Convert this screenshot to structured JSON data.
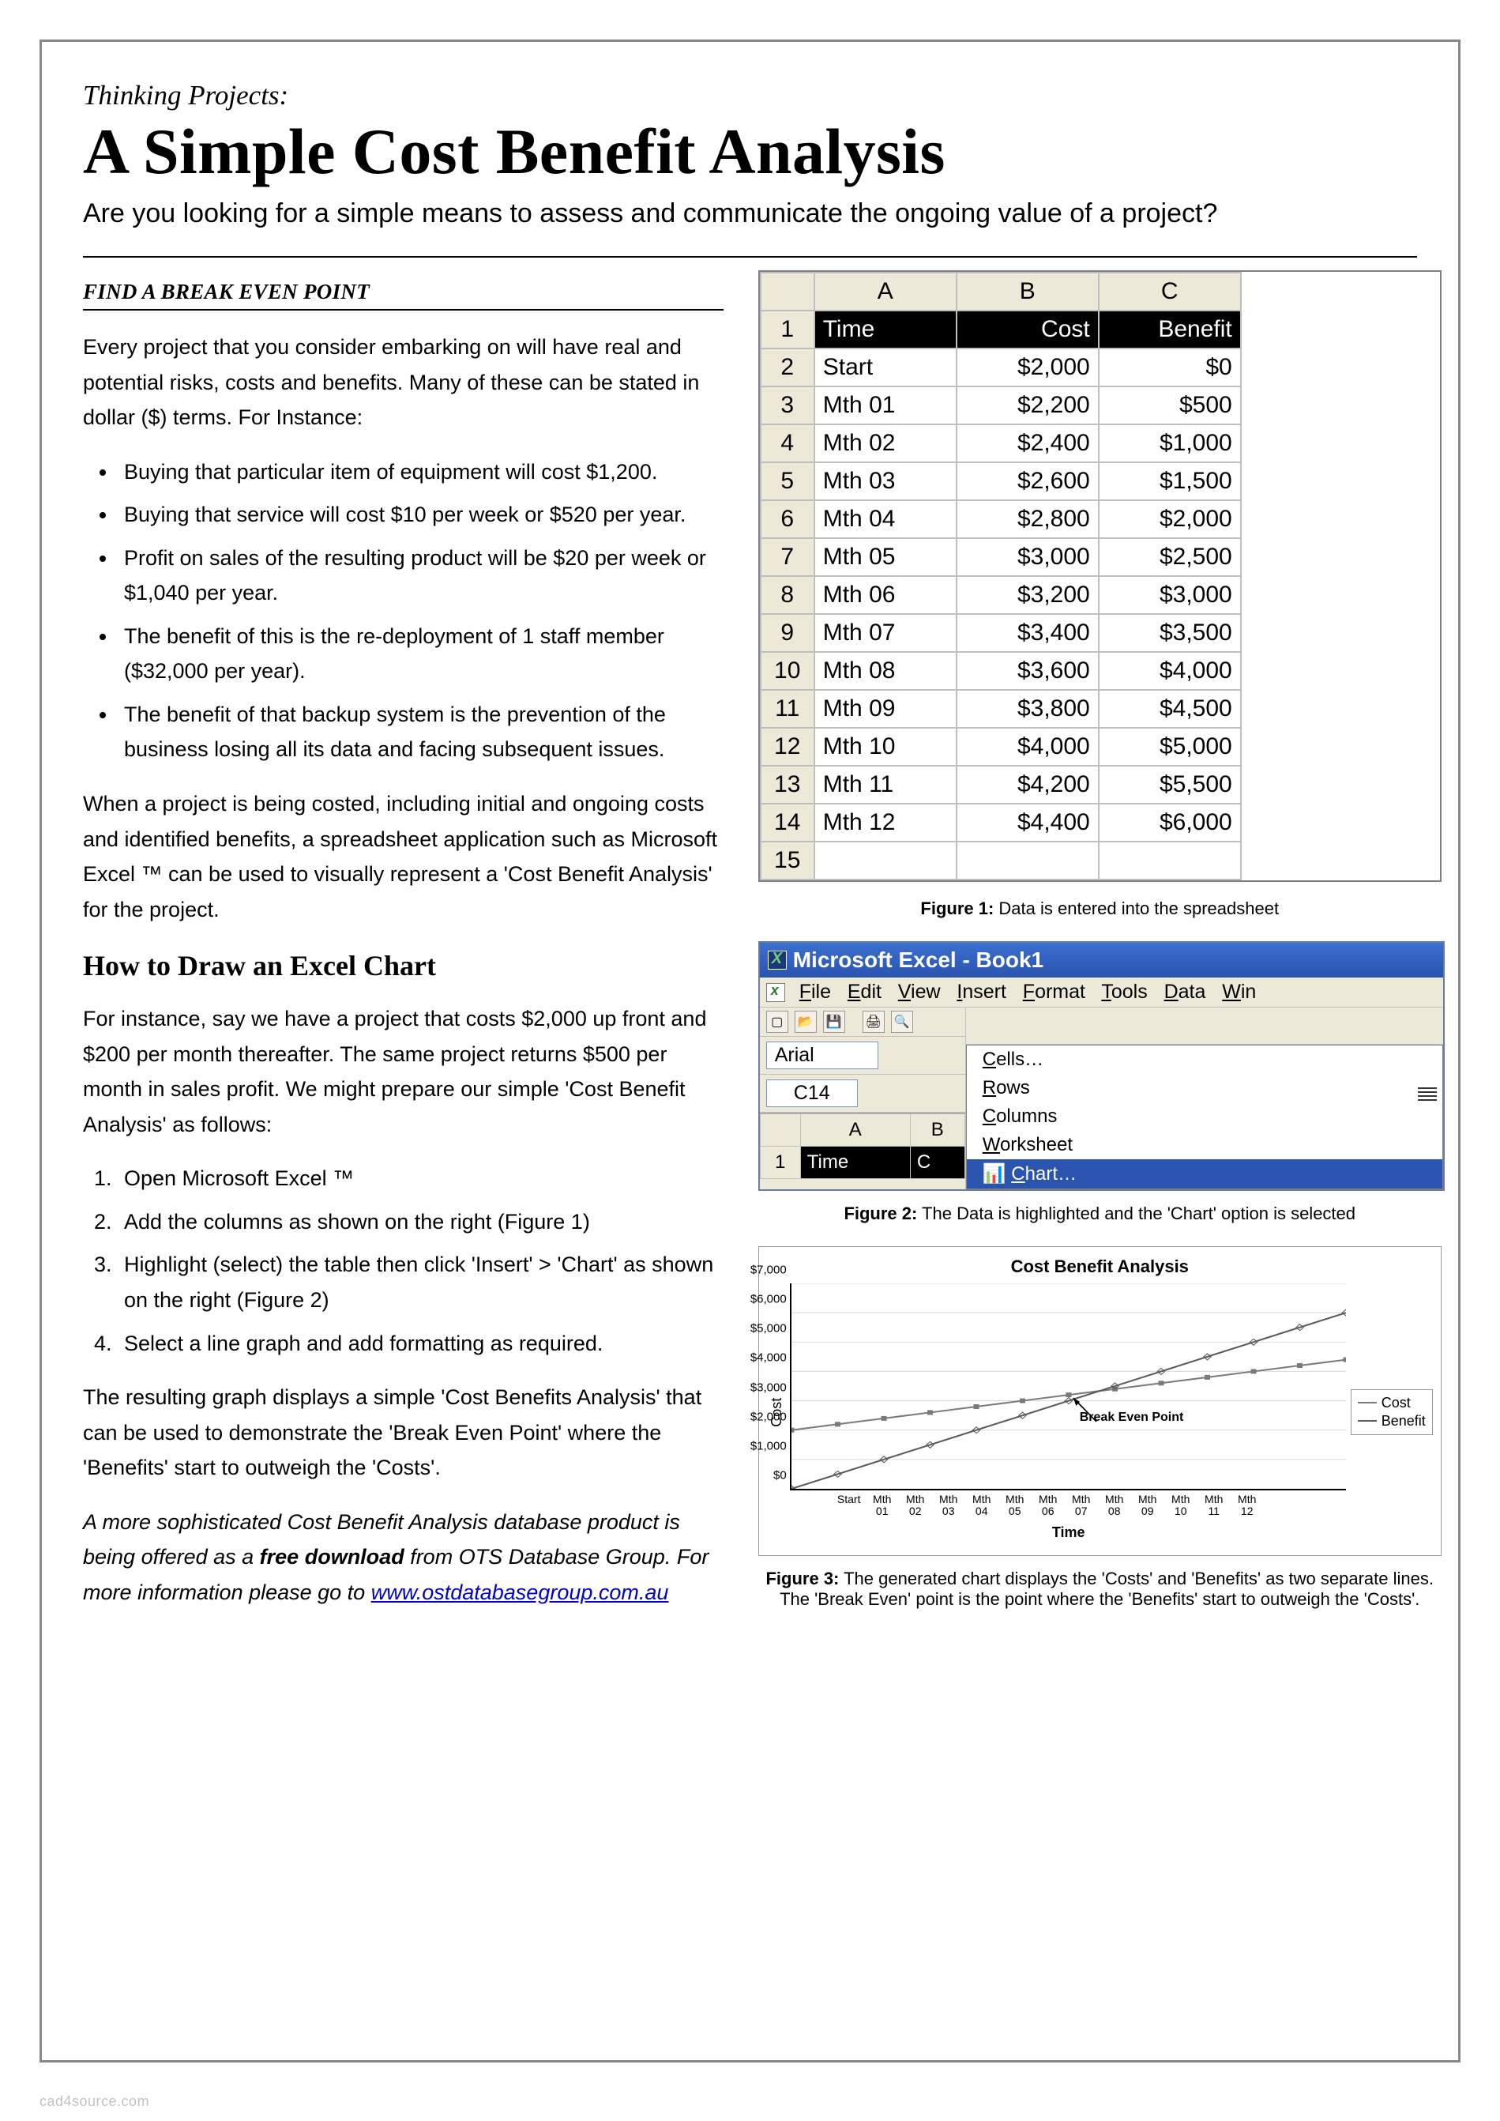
{
  "header": {
    "pre_title": "Thinking Projects:",
    "title": "A Simple Cost Benefit Analysis",
    "subtitle": "Are you looking for a simple means to assess and communicate the ongoing value of a project?"
  },
  "left": {
    "section_label": "FIND A BREAK EVEN POINT",
    "intro": "Every project that you consider embarking on will have real and potential risks, costs and benefits.  Many of these can be stated in dollar ($) terms.  For Instance:",
    "bullets": [
      "Buying that particular item of equipment will cost $1,200.",
      "Buying that service will cost $10 per week or $520 per year.",
      "Profit on sales of the resulting product will be $20 per week or $1,040 per year.",
      "The benefit of this is the re-deployment of 1 staff member ($32,000 per year).",
      "The benefit of that backup system is the prevention of the business losing all its data and facing subsequent issues."
    ],
    "para2": "When a project is being costed, including initial and ongoing costs and identified benefits, a spreadsheet application such as Microsoft Excel ™ can be used to visually represent a 'Cost Benefit Analysis' for the project.",
    "h2": "How to Draw an Excel Chart",
    "para3": "For instance, say we have a project that costs $2,000 up front and $200 per month thereafter. The same project returns $500 per month in sales profit.  We might prepare our simple 'Cost Benefit Analysis' as follows:",
    "steps": [
      "Open Microsoft Excel ™",
      "Add the columns as shown on the right (Figure 1)",
      "Highlight (select) the table then click 'Insert' > 'Chart' as shown on the right (Figure 2)",
      "Select a line graph and add formatting as required."
    ],
    "para4": "The resulting graph displays a simple 'Cost Benefits Analysis' that can be used to demonstrate the 'Break Even Point' where the 'Benefits' start to outweigh the 'Costs'.",
    "footer_italic_pre": "A more sophisticated Cost Benefit Analysis database product is being offered as a ",
    "footer_bold": "free download",
    "footer_italic_post": " from OTS Database Group.  For more information please go to ",
    "footer_link": "www.ostdatabasegroup.com.au"
  },
  "figure1": {
    "col_headers": [
      "A",
      "B",
      "C"
    ],
    "data_headers": [
      "Time",
      "Cost",
      "Benefit"
    ],
    "row_labels": [
      "1",
      "2",
      "3",
      "4",
      "5",
      "6",
      "7",
      "8",
      "9",
      "10",
      "11",
      "12",
      "13",
      "14",
      "15"
    ],
    "rows": [
      [
        "Start",
        "$2,000",
        "$0"
      ],
      [
        "Mth 01",
        "$2,200",
        "$500"
      ],
      [
        "Mth 02",
        "$2,400",
        "$1,000"
      ],
      [
        "Mth 03",
        "$2,600",
        "$1,500"
      ],
      [
        "Mth 04",
        "$2,800",
        "$2,000"
      ],
      [
        "Mth 05",
        "$3,000",
        "$2,500"
      ],
      [
        "Mth 06",
        "$3,200",
        "$3,000"
      ],
      [
        "Mth 07",
        "$3,400",
        "$3,500"
      ],
      [
        "Mth 08",
        "$3,600",
        "$4,000"
      ],
      [
        "Mth 09",
        "$3,800",
        "$4,500"
      ],
      [
        "Mth 10",
        "$4,000",
        "$5,000"
      ],
      [
        "Mth 11",
        "$4,200",
        "$5,500"
      ],
      [
        "Mth 12",
        "$4,400",
        "$6,000"
      ]
    ],
    "caption_b": "Figure 1:",
    "caption": " Data is entered into the spreadsheet"
  },
  "figure2": {
    "titlebar": "Microsoft Excel - Book1",
    "menu": [
      "File",
      "Edit",
      "View",
      "Insert",
      "Format",
      "Tools",
      "Data",
      "Win"
    ],
    "font": "Arial",
    "cellref": "C14",
    "mini_cols": [
      "A",
      "B"
    ],
    "mini_row": [
      "1",
      "Time",
      "C"
    ],
    "dropdown": [
      "Cells…",
      "Rows",
      "Columns",
      "Worksheet",
      "Chart…"
    ],
    "selected": "Chart…",
    "caption_b": "Figure 2:",
    "caption": "  The Data is highlighted and the 'Chart' option is selected"
  },
  "figure3": {
    "caption_b": "Figure 3:",
    "caption": " The generated chart displays the 'Costs' and 'Benefits' as two separate lines.  The 'Break Even' point is the point where the 'Benefits' start to outweigh the 'Costs'."
  },
  "chart_data": {
    "type": "line",
    "title": "Cost Benefit Analysis",
    "xlabel": "Time",
    "ylabel": "Cost",
    "ylim": [
      0,
      7000
    ],
    "yticks": [
      "$0",
      "$1,000",
      "$2,000",
      "$3,000",
      "$4,000",
      "$5,000",
      "$6,000",
      "$7,000"
    ],
    "categories": [
      "Start",
      "Mth 01",
      "Mth 02",
      "Mth 03",
      "Mth 04",
      "Mth 05",
      "Mth 06",
      "Mth 07",
      "Mth 08",
      "Mth 09",
      "Mth 10",
      "Mth 11",
      "Mth 12"
    ],
    "series": [
      {
        "name": "Cost",
        "color": "#7a7a7a",
        "values": [
          2000,
          2200,
          2400,
          2600,
          2800,
          3000,
          3200,
          3400,
          3600,
          3800,
          4000,
          4200,
          4400
        ]
      },
      {
        "name": "Benefit",
        "color": "#5a5a5a",
        "values": [
          0,
          500,
          1000,
          1500,
          2000,
          2500,
          3000,
          3500,
          4000,
          4500,
          5000,
          5500,
          6000
        ]
      }
    ],
    "annotation": "Break Even Point"
  },
  "watermark": "cad4source.com"
}
